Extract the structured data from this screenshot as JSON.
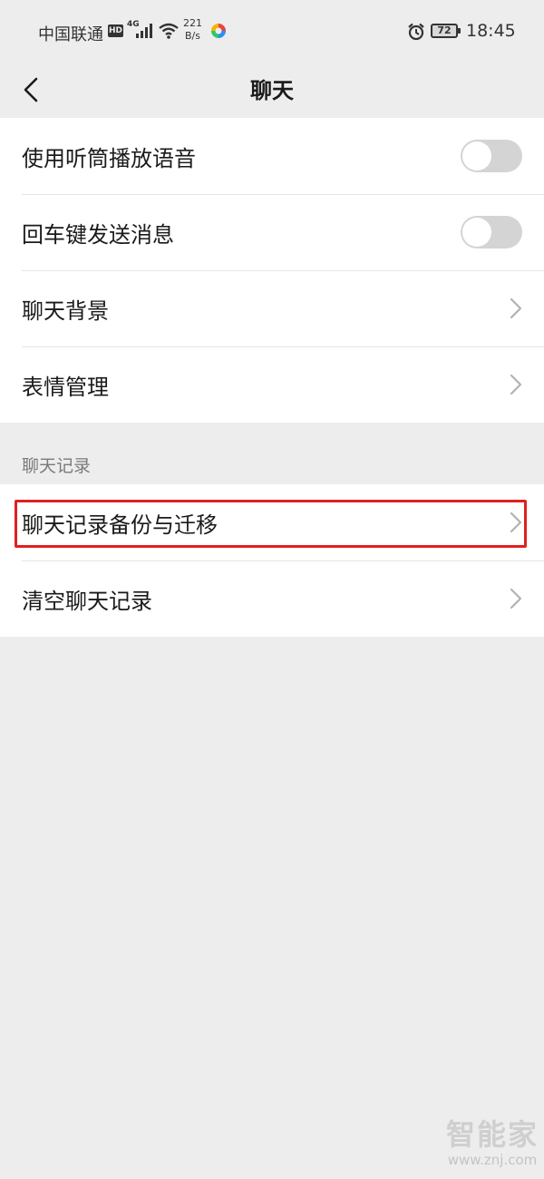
{
  "status_bar": {
    "carrier": "中国联通",
    "hd_badge": "HD",
    "network_type": "4G",
    "speed_value": "221",
    "speed_unit": "B/s",
    "battery_level": "72",
    "time": "18:45"
  },
  "nav": {
    "title": "聊天"
  },
  "settings_group": {
    "items": [
      {
        "label": "使用听筒播放语音",
        "control": "toggle",
        "on": false
      },
      {
        "label": "回车键发送消息",
        "control": "toggle",
        "on": false
      },
      {
        "label": "聊天背景",
        "control": "chevron"
      },
      {
        "label": "表情管理",
        "control": "chevron"
      }
    ]
  },
  "chat_history_section": {
    "header": "聊天记录",
    "items": [
      {
        "label": "聊天记录备份与迁移",
        "control": "chevron",
        "highlighted": true
      },
      {
        "label": "清空聊天记录",
        "control": "chevron"
      }
    ]
  },
  "watermark": {
    "logo_text": "智能家",
    "url": "www.znj.com"
  },
  "colors": {
    "background": "#ededed",
    "card": "#ffffff",
    "toggle_off": "#d4d4d4",
    "highlight": "#e02020",
    "section_header": "#7a7a7a"
  }
}
